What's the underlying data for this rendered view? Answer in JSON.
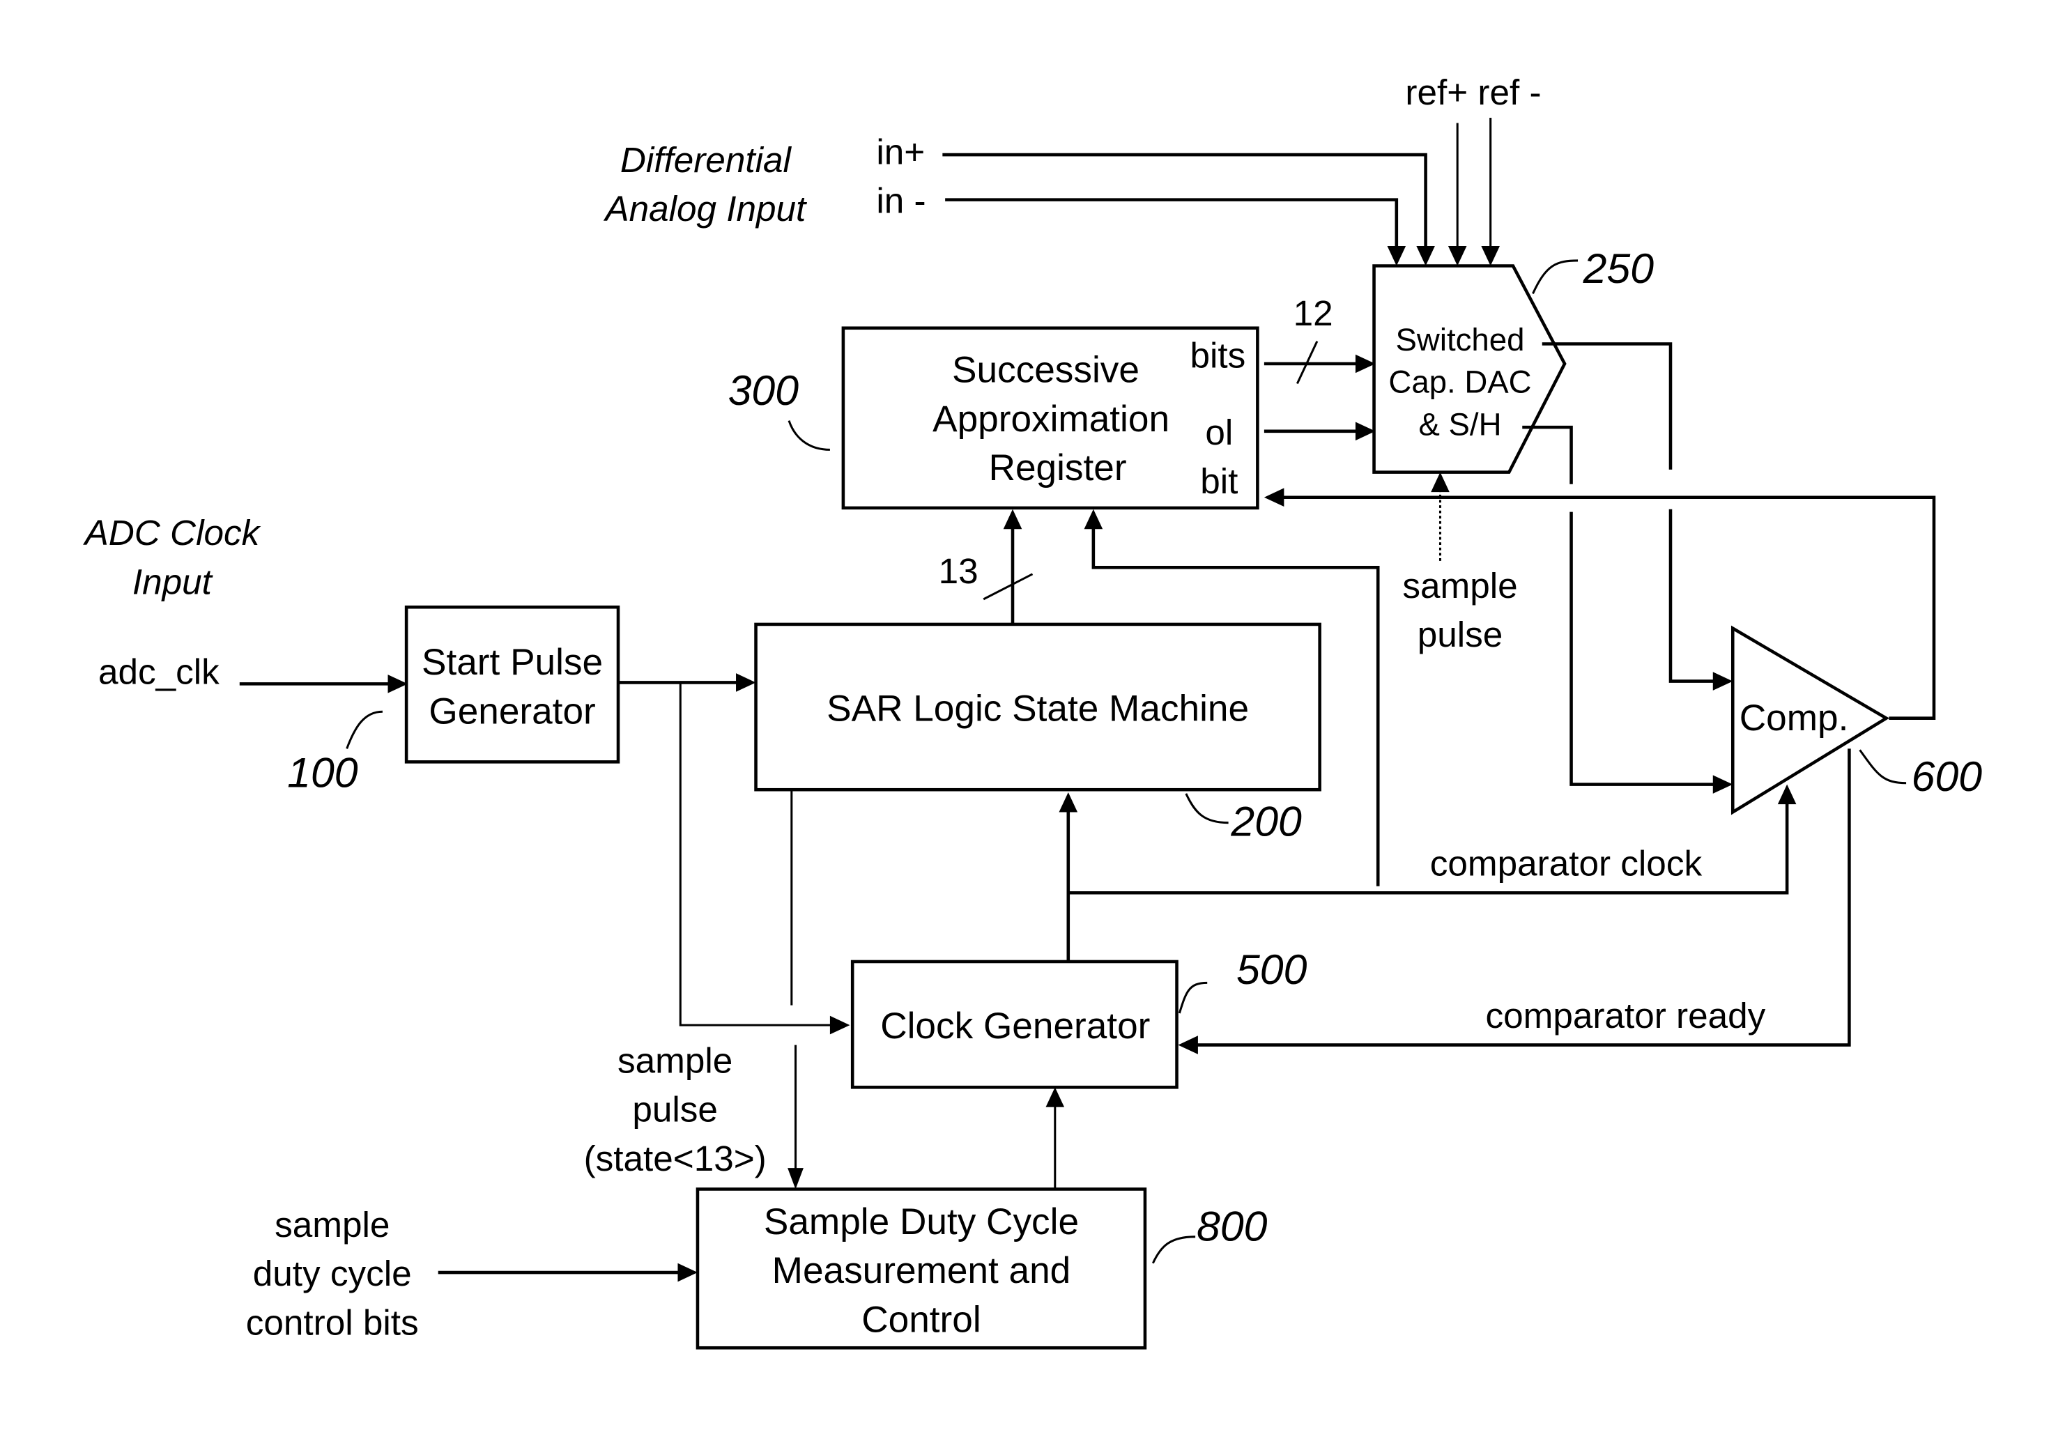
{
  "figure": {
    "type": "block-diagram",
    "description": "SAR ADC block diagram"
  },
  "labels": {
    "differential_analog_input": [
      "Differential",
      "Analog Input"
    ],
    "adc_clock_input": [
      "ADC Clock",
      "Input"
    ],
    "in_plus": "in+",
    "in_minus": "in -",
    "ref": "ref+ ref -",
    "adc_clk": "adc_clk",
    "bus_12": "12",
    "bus_13": "13",
    "bits": "bits",
    "ol": "ol",
    "bit": "bit",
    "sample_pulse_top": [
      "sample",
      "pulse"
    ],
    "comparator_clock": "comparator clock",
    "comparator_ready": "comparator ready",
    "sample_pulse_state": [
      "sample",
      "pulse",
      "(state<13>)"
    ],
    "sample_duty_cycle_control_bits": [
      "sample",
      "duty cycle",
      "control bits"
    ]
  },
  "blocks": {
    "start_pulse": {
      "lines": [
        "Start Pulse",
        "Generator"
      ],
      "ref": "100"
    },
    "sar_logic": {
      "lines": [
        "SAR Logic State Machine"
      ],
      "ref": "200"
    },
    "dac": {
      "lines": [
        "Switched",
        "Cap. DAC",
        "& S/H"
      ],
      "ref": "250"
    },
    "sar_register": {
      "lines": [
        "Successive",
        "Approximation",
        "Register"
      ],
      "ref": "300"
    },
    "clock_gen": {
      "lines": [
        "Clock Generator"
      ],
      "ref": "500"
    },
    "comparator": {
      "lines": [
        "Comp."
      ],
      "ref": "600"
    },
    "duty_cycle": {
      "lines": [
        "Sample Duty Cycle",
        "Measurement and",
        "Control"
      ],
      "ref": "800"
    }
  }
}
